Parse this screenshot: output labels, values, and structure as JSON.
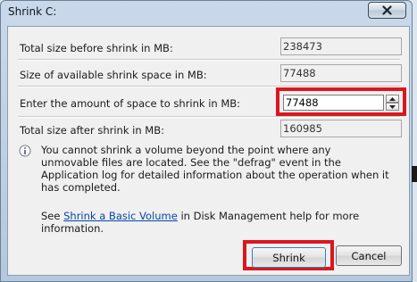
{
  "window": {
    "title": "Shrink C:"
  },
  "fields": {
    "total_before_label": "Total size before shrink in MB:",
    "total_before_value": "238473",
    "available_label": "Size of available shrink space in MB:",
    "available_value": "77488",
    "amount_label": "Enter the amount of space to shrink in MB:",
    "amount_value": "77488",
    "total_after_label": "Total size after shrink in MB:",
    "total_after_value": "160985"
  },
  "info": {
    "message": "You cannot shrink a volume beyond the point where any unmovable files are located. See the \"defrag\" event in the Application log for detailed information about the operation when it has completed."
  },
  "help": {
    "prefix": "See ",
    "link_text": "Shrink a Basic Volume",
    "suffix": " in Disk Management help for more information."
  },
  "buttons": {
    "shrink": "Shrink",
    "cancel": "Cancel"
  },
  "colors": {
    "highlight": "#d9171f",
    "link": "#0645ad"
  },
  "icons": {
    "close": "close-icon",
    "info": "info-icon",
    "spin_up": "spin-up-icon",
    "spin_down": "spin-down-icon"
  }
}
